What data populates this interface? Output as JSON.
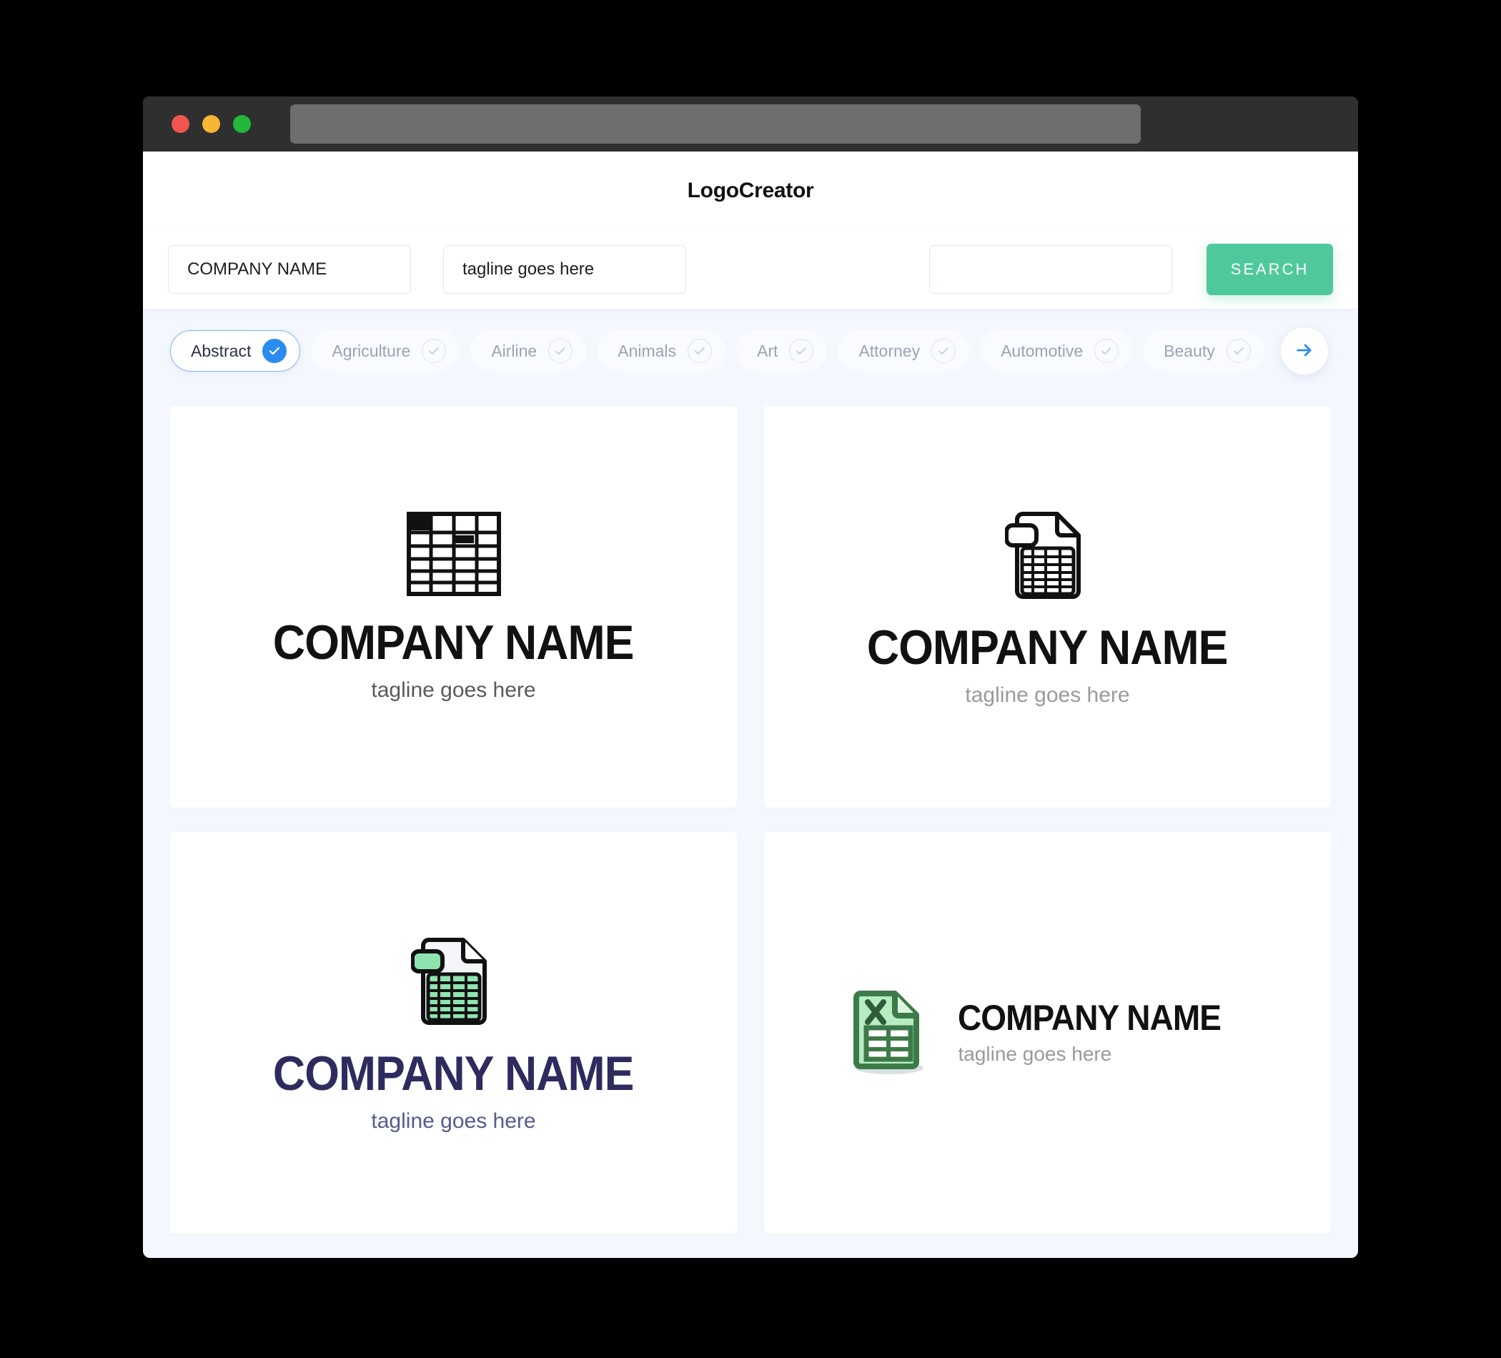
{
  "window": {
    "traffic_lights": [
      "close",
      "minimize",
      "maximize"
    ],
    "url_value": ""
  },
  "header": {
    "app_title": "LogoCreator"
  },
  "search": {
    "company_value": "COMPANY NAME",
    "company_placeholder": "COMPANY NAME",
    "tagline_value": "tagline goes here",
    "tagline_placeholder": "tagline goes here",
    "extra_value": "",
    "extra_placeholder": "",
    "search_button": "SEARCH"
  },
  "categories": {
    "next_icon": "arrow-right-icon",
    "items": [
      {
        "label": "Abstract",
        "selected": true
      },
      {
        "label": "Agriculture",
        "selected": false
      },
      {
        "label": "Airline",
        "selected": false
      },
      {
        "label": "Animals",
        "selected": false
      },
      {
        "label": "Art",
        "selected": false
      },
      {
        "label": "Attorney",
        "selected": false
      },
      {
        "label": "Automotive",
        "selected": false
      },
      {
        "label": "Beauty",
        "selected": false
      }
    ]
  },
  "results": [
    {
      "icon": "spreadsheet-grid-icon",
      "name": "COMPANY NAME",
      "tagline": "tagline goes here",
      "name_color": "#111111",
      "tagline_color": "#5a5a5a",
      "layout": "stacked"
    },
    {
      "icon": "document-table-outline-icon",
      "name": "COMPANY NAME",
      "tagline": "tagline goes here",
      "name_color": "#111111",
      "tagline_color": "#9a9a9a",
      "layout": "stacked"
    },
    {
      "icon": "document-table-green-icon",
      "name": "COMPANY NAME",
      "tagline": "tagline goes here",
      "name_color": "#2e2b5f",
      "tagline_color": "#555b8e",
      "layout": "stacked"
    },
    {
      "icon": "excel-file-icon",
      "name": "COMPANY NAME",
      "tagline": "tagline goes here",
      "name_color": "#111111",
      "tagline_color": "#9a9a9a",
      "layout": "horizontal"
    }
  ],
  "colors": {
    "accent_green": "#4fc99c",
    "accent_blue": "#2b8cf0",
    "page_background": "#f4f7fe",
    "titlebar": "#2f2f2f",
    "navy": "#2e2b5f",
    "logo_green": "#8fe3af",
    "logo_green_dark": "#3c7a4a"
  }
}
